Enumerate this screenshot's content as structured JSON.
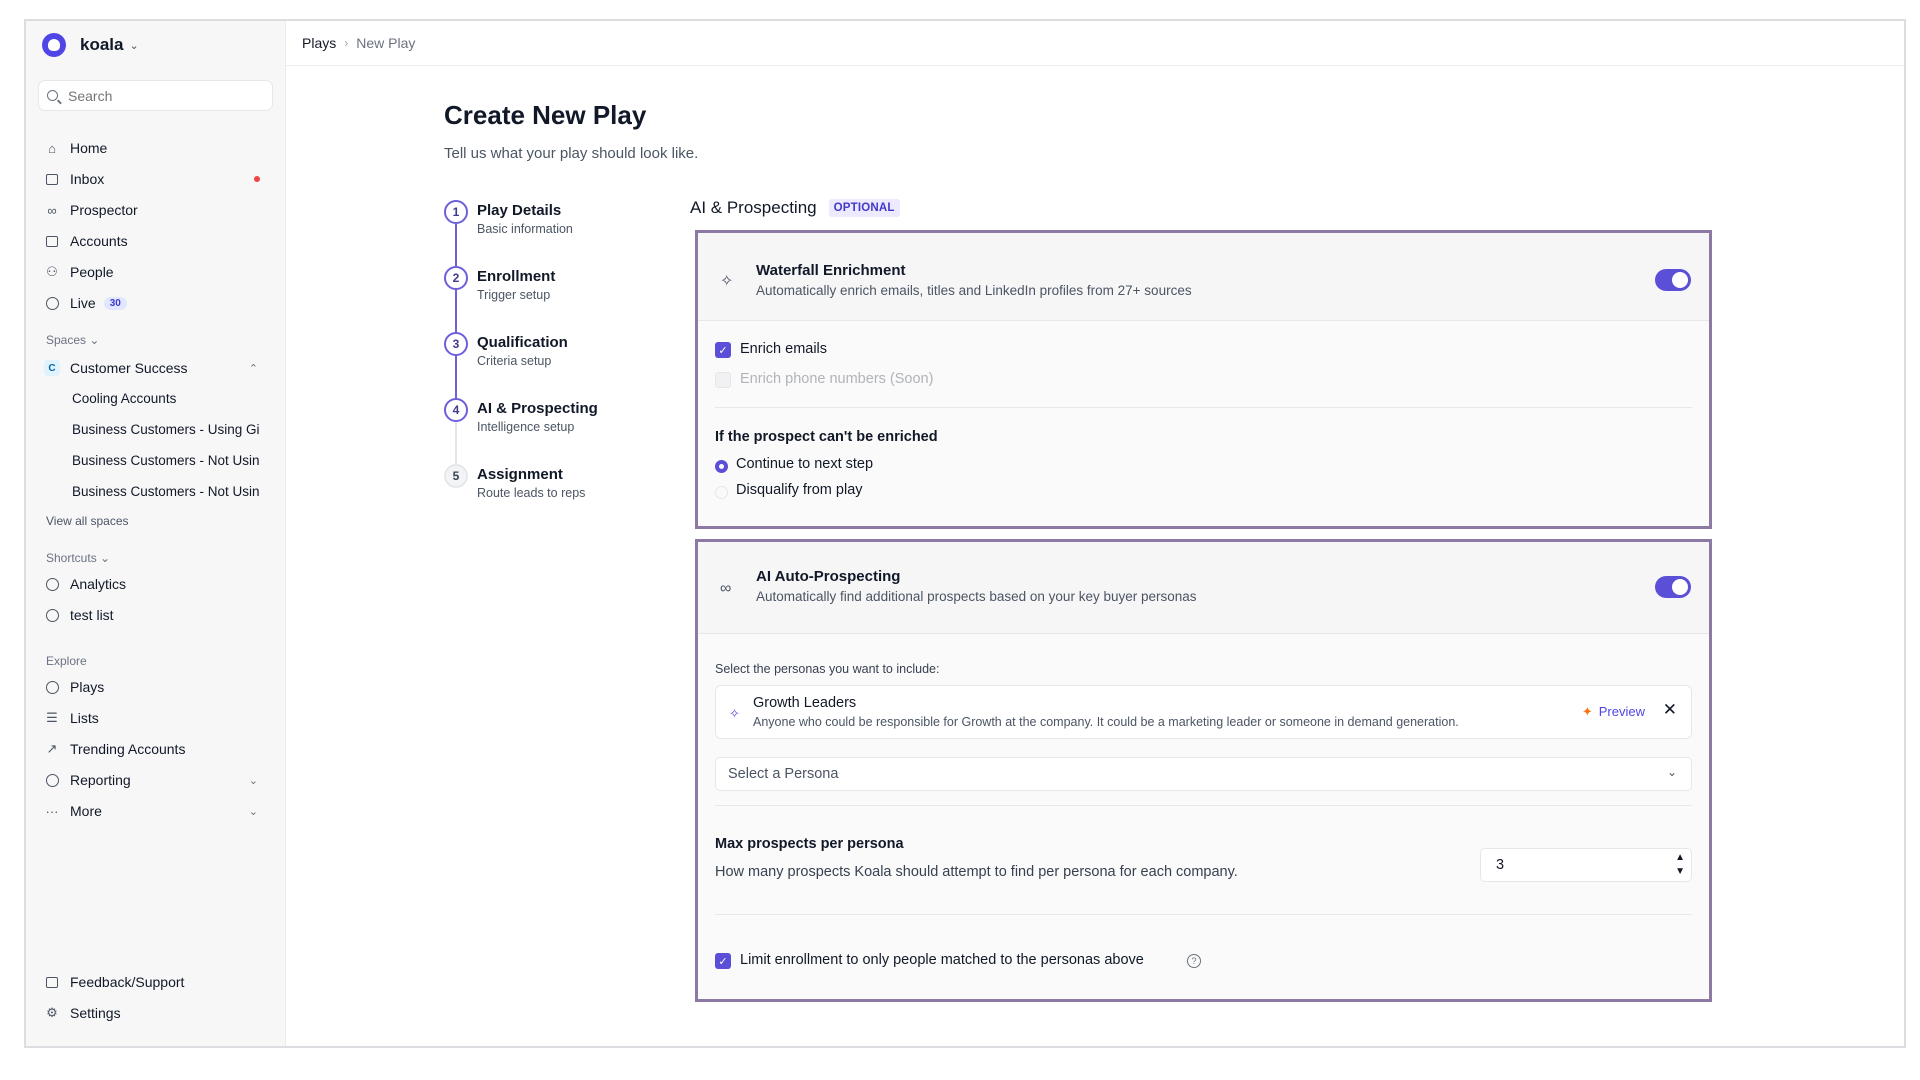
{
  "brand": {
    "name": "koala"
  },
  "search": {
    "placeholder": "Search"
  },
  "nav": {
    "home": "Home",
    "inbox": "Inbox",
    "prospector": "Prospector",
    "accounts": "Accounts",
    "people": "People",
    "live": "Live",
    "live_badge": "30"
  },
  "spaces": {
    "label": "Spaces",
    "space_name": "Customer Success",
    "space_letter": "C",
    "items": [
      "Cooling Accounts",
      "Business Customers - Using Gi",
      "Business Customers - Not Usin",
      "Business Customers - Not Usin"
    ],
    "view_all": "View all spaces"
  },
  "shortcuts": {
    "label": "Shortcuts",
    "items": [
      "Analytics",
      "test list"
    ]
  },
  "explore": {
    "label": "Explore",
    "plays": "Plays",
    "lists": "Lists",
    "trending": "Trending Accounts",
    "reporting": "Reporting",
    "more": "More"
  },
  "footer": {
    "feedback": "Feedback/Support",
    "settings": "Settings"
  },
  "breadcrumb": {
    "parent": "Plays",
    "current": "New Play"
  },
  "page": {
    "title": "Create New Play",
    "subtitle": "Tell us what your play should look like."
  },
  "steps": [
    {
      "num": "1",
      "title": "Play Details",
      "sub": "Basic information"
    },
    {
      "num": "2",
      "title": "Enrollment",
      "sub": "Trigger setup"
    },
    {
      "num": "3",
      "title": "Qualification",
      "sub": "Criteria setup"
    },
    {
      "num": "4",
      "title": "AI & Prospecting",
      "sub": "Intelligence setup"
    },
    {
      "num": "5",
      "title": "Assignment",
      "sub": "Route leads to reps"
    }
  ],
  "section": {
    "title": "AI & Prospecting",
    "badge": "OPTIONAL"
  },
  "waterfall": {
    "title": "Waterfall Enrichment",
    "desc": "Automatically enrich emails, titles and LinkedIn profiles from 27+ sources",
    "enabled": true,
    "enrich_emails": "Enrich emails",
    "enrich_phones": "Enrich phone numbers (Soon)",
    "fallback_label": "If the prospect can't be enriched",
    "opt_continue": "Continue to next step",
    "opt_disqualify": "Disqualify from play",
    "selected_option": "Continue to next step"
  },
  "auto_prospecting": {
    "title": "AI Auto-Prospecting",
    "desc": "Automatically find additional prospects based on your key buyer personas",
    "enabled": true,
    "persona_prompt": "Select the personas you want to include:",
    "persona": {
      "name": "Growth Leaders",
      "desc": "Anyone who could be responsible for Growth at the company. It could be a marketing leader or someone in demand generation.",
      "preview": "Preview"
    },
    "select_placeholder": "Select a Persona",
    "max_label": "Max prospects per persona",
    "max_desc": "How many prospects Koala should attempt to find per persona for each company.",
    "max_value": "3",
    "limit_label": "Limit enrollment to only people matched to the personas above"
  },
  "colors": {
    "accent": "#5b4fd8",
    "highlight_border": "#8c7aa5",
    "alert": "#ef4444"
  }
}
